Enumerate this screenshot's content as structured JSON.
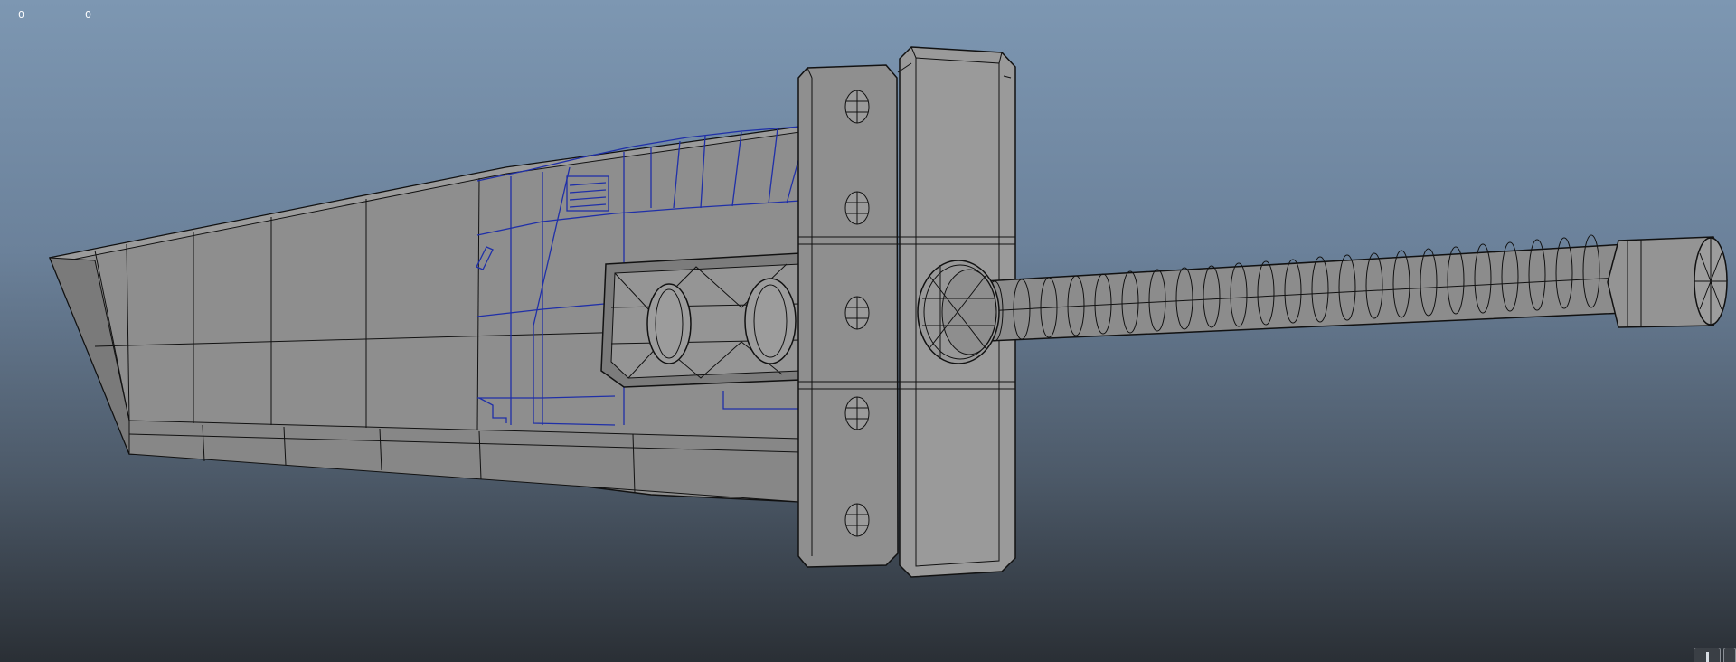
{
  "viewport": {
    "hud_values": [
      "0",
      "0"
    ],
    "background_top": "#7d97b2",
    "background_bottom": "#2a2f35"
  },
  "model": {
    "wireframe_color": "#1a1a1a",
    "selection_color": "#1f2fa8",
    "surface_color": "#8f8f8f"
  },
  "icons": [
    "view-control-icon",
    "view-control-icon"
  ]
}
